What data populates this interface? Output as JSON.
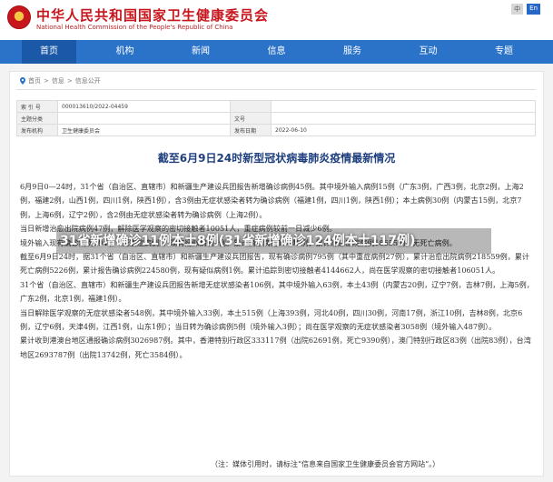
{
  "header": {
    "title": "中华人民共和国国家卫生健康委员会",
    "subtitle": "National Health Commission of the People's Republic of China",
    "lang_links": [
      "中",
      "En"
    ]
  },
  "nav": {
    "items": [
      "首页",
      "机构",
      "新闻",
      "信息",
      "服务",
      "互动",
      "专题"
    ]
  },
  "breadcrumb": {
    "items": [
      "首页",
      ">",
      "信息",
      ">",
      "信息公开"
    ]
  },
  "meta": {
    "index_label": "索 引 号",
    "index_value": "000013610/2022-04459",
    "category_label": "主题分类",
    "category_value": "",
    "doc_no_label": "文号",
    "doc_no_value": "",
    "issuer_label": "发布机构",
    "issuer_value": "卫生健康委员会",
    "date_label": "发布日期",
    "date_value": "2022-06-10"
  },
  "article": {
    "title": "截至6月9日24时新型冠状病毒肺炎疫情最新情况",
    "paragraphs": [
      "6月9日0—24时，31个省（自治区、直辖市）和新疆生产建设兵团报告新增确诊病例45例。其中境外输入病例15例（广东3例，广西3例，北京2例，上海2例，福建2例，山西1例，四川1例，陕西1例），含3例由无症状感染者转为确诊病例（福建1例，四川1例，陕西1例）；本土病例30例（内蒙古15例，北京7例，上海6例，辽宁2例），含2例由无症状感染者转为确诊病例（上海2例）。",
      "当日新增治愈出院病例47例，解除医学观察的密切接触者10051人，重症病例较前一日减少6例。",
      "境外输入现有确诊病例194例（无重症病例），现有疑似病例1例。累计确诊病例18849例，累计治愈出院病例18655例，无死亡病例。",
      "截至6月9日24时，据31个省（自治区、直辖市）和新疆生产建设兵团报告，现有确诊病例795例（其中重症病例27例），累计治愈出院病例218559例，累计死亡病例5226例，累计报告确诊病例224580例，现有疑似病例1例。累计追踪到密切接触者4144662人，尚在医学观察的密切接触者106051人。",
      "31个省（自治区、直辖市）和新疆生产建设兵团报告新增无症状感染者106例，其中境外输入63例，本土43例（内蒙古20例，辽宁7例，吉林7例，上海5例，广东2例，北京1例，福建1例）。",
      "当日解除医学观察的无症状感染者548例，其中境外输入33例，本土515例（上海393例，河北40例，四川30例，河南17例，浙江10例，吉林8例，北京6例，辽宁6例，天津4例，江西1例，山东1例）；当日转为确诊病例5例（境外输入3例）；尚在医学观察的无症状感染者3058例（境外输入487例）。",
      "累计收到港澳台地区通报确诊病例3026987例。其中，香港特别行政区333117例（出院62691例，死亡9390例），澳门特别行政区83例（出院83例），台湾地区2693787例（出院13742例，死亡3584例）。"
    ],
    "note": "（注：媒体引用时，请标注“信息来自国家卫生健康委员会官方网站”。）"
  },
  "overlay": {
    "caption": "31省新增确诊11例本土8例(31省新增确诊124例本土117例)"
  },
  "colors": {
    "brand_red": "#c8161d",
    "nav_blue": "#2b73c8",
    "title_blue": "#1f3f7e"
  }
}
